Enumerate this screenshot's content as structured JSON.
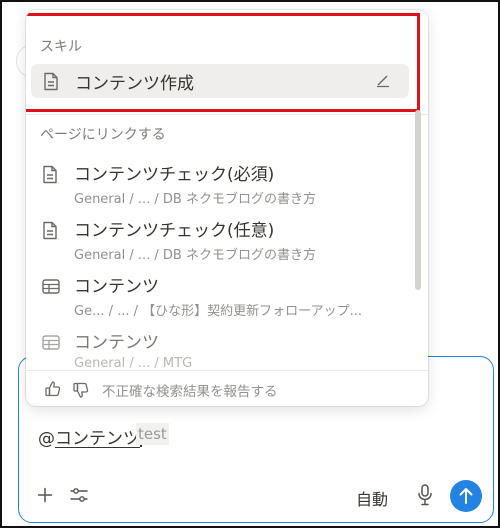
{
  "popup": {
    "skills_title": "スキル",
    "skill_item": {
      "label": "コンテンツ作成",
      "icon": "document-icon"
    },
    "link_section_title": "ページにリンクする",
    "items": [
      {
        "title": "コンテンツチェック(必須)",
        "path": "General / ... / DB ネクモブログの書き方",
        "icon": "document-icon"
      },
      {
        "title": "コンテンツチェック(任意)",
        "path": "General / ... / DB ネクモブログの書き方",
        "icon": "document-icon"
      },
      {
        "title": "コンテンツ",
        "path": "Ge... / ... / 【ひな形】契約更新フォローアップ...",
        "icon": "table-icon"
      },
      {
        "title": "コンテンツ",
        "path": "General / ... / MTG",
        "icon": "table-icon"
      }
    ],
    "report_label": "不正確な検索結果を報告する"
  },
  "composer": {
    "at_symbol": "@",
    "mention_query": "コンテンツ",
    "ghost_text": "test",
    "mode_label": "自動"
  },
  "colors": {
    "accent": "#2383e2",
    "highlight_border": "#e0111b",
    "selected_row": "#efeeec"
  }
}
